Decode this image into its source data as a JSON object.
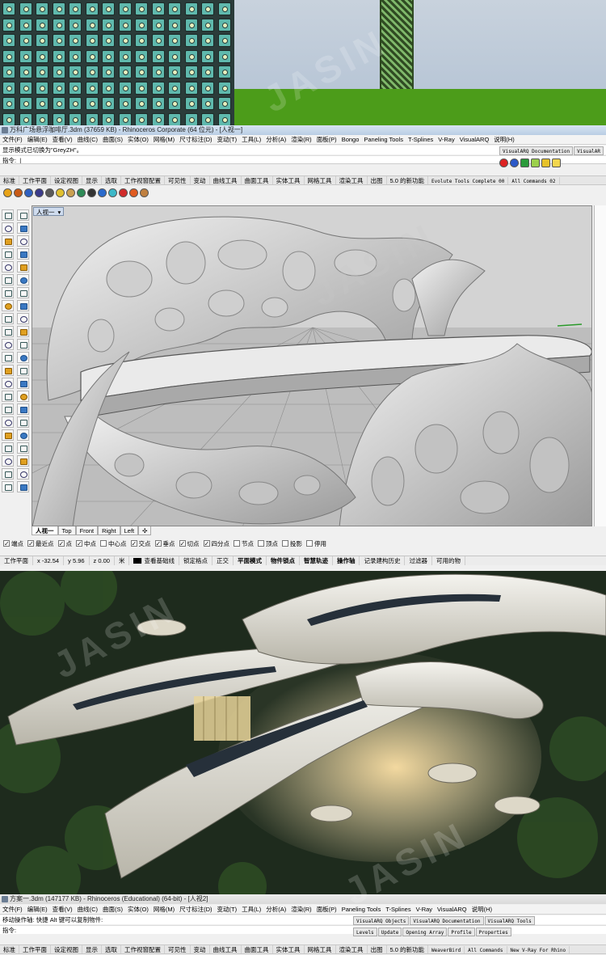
{
  "rhino1": {
    "title": "万科广场悬浮咖啡厅.3dm (37659 KB) - Rhinoceros Corporate (64 位元) - [人视一]",
    "menu": [
      "文件(F)",
      "编辑(E)",
      "查看(V)",
      "曲线(C)",
      "曲面(S)",
      "实体(O)",
      "网格(M)",
      "尺寸标注(D)",
      "变动(T)",
      "工具(L)",
      "分析(A)",
      "渲染(R)",
      "面板(P)",
      "Bongo",
      "Paneling Tools",
      "T-Splines",
      "V-Ray",
      "VisualARQ",
      "说明(H)"
    ],
    "history_line": "显示模式已切换为\"GreyZH\"。",
    "command_label": "指令:",
    "doc_tabs": [
      "VisualARQ Documentation",
      "VisualAR"
    ],
    "toolbar_tabs": [
      "标准",
      "工作平面",
      "设定视图",
      "显示",
      "选取",
      "工作视窗配置",
      "可见性",
      "变动",
      "曲线工具",
      "曲面工具",
      "实体工具",
      "网格工具",
      "渲染工具",
      "出图",
      "5.0 的新功能",
      "Evolute Tools Complete 00",
      "All Commands 02"
    ],
    "viewport_label": "人视一",
    "viewport_tabs": [
      "人视一",
      "Top",
      "Front",
      "Right",
      "Left"
    ],
    "osnaps": [
      {
        "label": "端点",
        "checked": true
      },
      {
        "label": "最近点",
        "checked": true
      },
      {
        "label": "点",
        "checked": true
      },
      {
        "label": "中点",
        "checked": true
      },
      {
        "label": "中心点",
        "checked": false
      },
      {
        "label": "交点",
        "checked": true
      },
      {
        "label": "垂点",
        "checked": true
      },
      {
        "label": "切点",
        "checked": true
      },
      {
        "label": "四分点",
        "checked": true
      },
      {
        "label": "节点",
        "checked": false
      },
      {
        "label": "顶点",
        "checked": false
      },
      {
        "label": "投影",
        "checked": false
      },
      {
        "label": "停用",
        "checked": false
      }
    ],
    "status": {
      "cplane": "工作平面",
      "x": "x -32.54",
      "y": "y 5.96",
      "z": "z 0.00",
      "unit": "米",
      "layer": "查看基础线",
      "items": [
        "锁定格点",
        "正交",
        "平面模式",
        "物件锁点",
        "智慧轨迹",
        "操作轴",
        "记录建构历史",
        "过滤器",
        "可用的物"
      ]
    }
  },
  "rhino2": {
    "title": "方案一.3dm (147177 KB) - Rhinoceros (Educational) (64-bit) - [人视2]",
    "menu": [
      "文件(F)",
      "编辑(E)",
      "查看(V)",
      "曲线(C)",
      "曲面(S)",
      "实体(O)",
      "网格(M)",
      "尺寸标注(D)",
      "变动(T)",
      "工具(L)",
      "分析(A)",
      "渲染(R)",
      "面板(P)",
      "Paneling Tools",
      "T-Splines",
      "V-Ray",
      "VisualARQ",
      "说明(H)"
    ],
    "history_line": "移动操作轴: 快捷 Alt 键可以复制物件:",
    "command_label": "指令:",
    "doc_tabs": [
      "VisualARQ Objects",
      "VisualARQ Documentation",
      "VisualARQ Tools"
    ],
    "vtools": [
      "Levels",
      "Update",
      "Opening Array",
      "Profile",
      "Properties"
    ],
    "toolbar_tabs": [
      "标准",
      "工作平面",
      "设定视图",
      "显示",
      "选取",
      "工作视窗配置",
      "可见性",
      "变动",
      "曲线工具",
      "曲面工具",
      "实体工具",
      "网格工具",
      "渲染工具",
      "出图",
      "5.0 的新功能",
      "WeaverBird",
      "All Commands",
      "New V-Ray For Rhino"
    ]
  },
  "colors": {
    "teal_tile": "#5fb9ad",
    "grass": "#4c9c1a",
    "viewport_bg": "#c9c9c9",
    "night_bg": "#1d2a1c",
    "building": "#e8e6df"
  },
  "icons": {
    "left_toolbar": 44,
    "top_toolbar": 14
  }
}
